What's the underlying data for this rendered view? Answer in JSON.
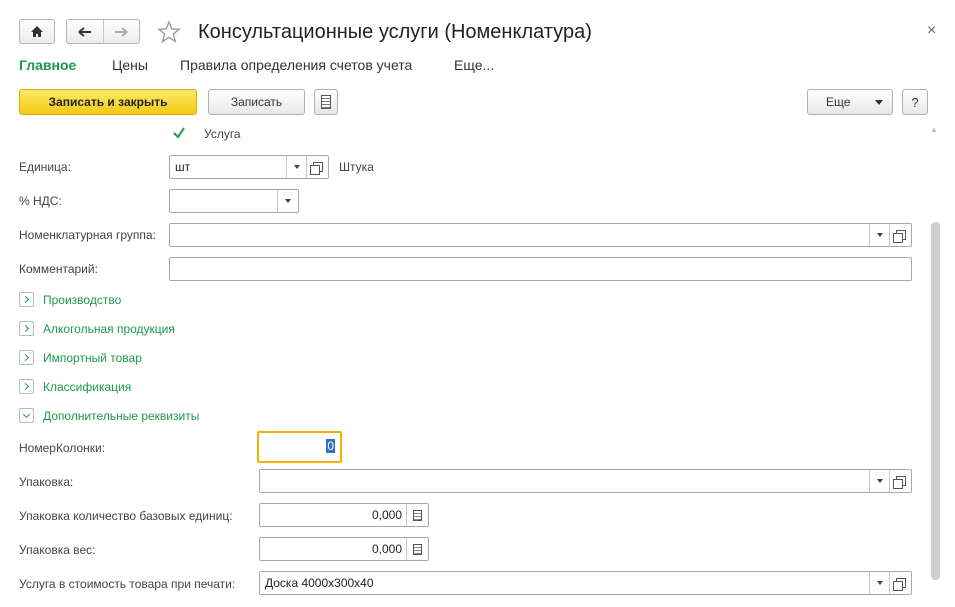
{
  "window": {
    "title": "Консультационные услуги (Номенклатура)",
    "close_glyph": "×"
  },
  "tabs": [
    {
      "label": "Главное",
      "active": true
    },
    {
      "label": "Цены"
    },
    {
      "label": "Правила определения счетов учета"
    },
    {
      "label": "Еще..."
    }
  ],
  "toolbar": {
    "save_close_label": "Записать и закрыть",
    "save_label": "Записать",
    "more_label": "Еще",
    "help_label": "?"
  },
  "form": {
    "service_checkbox_label": "Услуга",
    "service_checked": true,
    "unit_label": "Единица:",
    "unit_value": "шт",
    "unit_name": "Штука",
    "vat_label": "% НДС:",
    "vat_value": "",
    "group_label": "Номенклатурная группа:",
    "group_value": "",
    "comment_label": "Комментарий:",
    "comment_value": ""
  },
  "sections": [
    {
      "label": "Производство",
      "expanded": false
    },
    {
      "label": "Алкогольная продукция",
      "expanded": false
    },
    {
      "label": "Импортный товар",
      "expanded": false
    },
    {
      "label": "Классификация",
      "expanded": false
    },
    {
      "label": "Дополнительные реквизиты",
      "expanded": true
    }
  ],
  "extra": {
    "column_no_label": "НомерКолонки:",
    "column_no_value": "0",
    "package_label": "Упаковка:",
    "package_value": "",
    "pkg_qty_label": "Упаковка количество базовых единиц:",
    "pkg_qty_value": "0,000",
    "pkg_weight_label": "Упаковка вес:",
    "pkg_weight_value": "0,000",
    "service_print_label": "Услуга в стоимость товара при печати:",
    "service_print_value": "Доска 4000х300х40"
  },
  "colors": {
    "accent_green": "#1a9a4b",
    "primary_yellow": "#f5c912",
    "focus_orange": "#f0b400"
  }
}
